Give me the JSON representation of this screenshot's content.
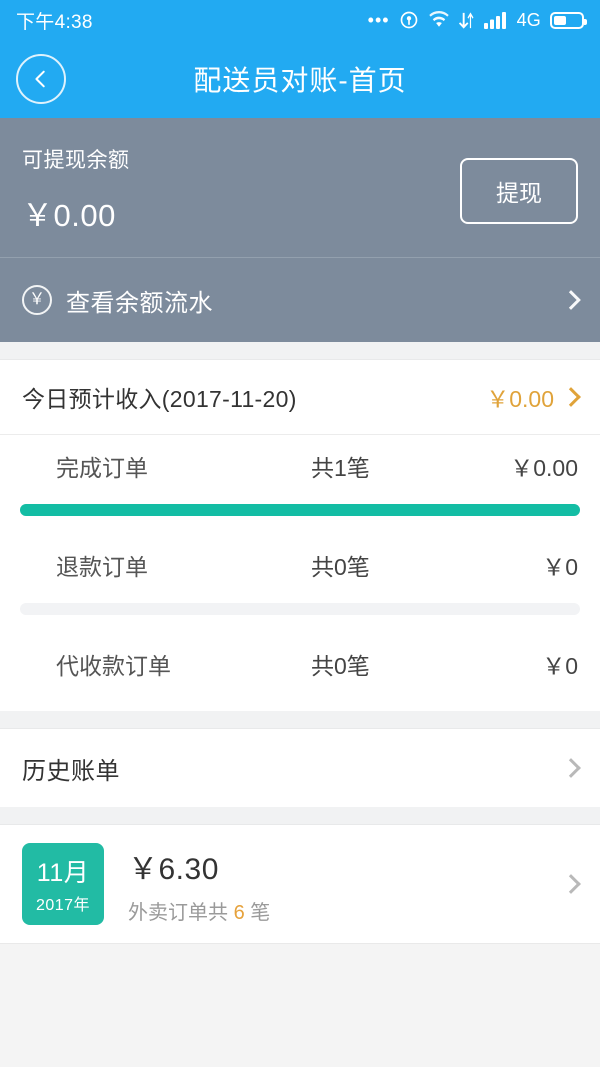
{
  "statusbar": {
    "time": "下午4:38",
    "dots": "•••",
    "network_label": "4G",
    "icons": [
      "more-dots-icon",
      "location-icon",
      "wifi-icon",
      "data-transfer-icon",
      "signal-bars-icon",
      "battery-icon"
    ]
  },
  "navbar": {
    "title": "配送员对账-首页",
    "back_icon": "chevron-left-icon"
  },
  "balance": {
    "label": "可提现余额",
    "amount": "￥0.00",
    "withdraw_label": "提现",
    "bg_color": "#7d8b9c"
  },
  "flow": {
    "icon": "yen-circle-icon",
    "label": "查看余额流水",
    "chevron": "chevron-right-icon"
  },
  "income": {
    "title": "今日预计收入(2017-11-20)",
    "amount": "￥0.00",
    "amount_color": "#e0a33a",
    "chevron": "chevron-right-icon",
    "rows": [
      {
        "name": "完成订单",
        "count": "共1笔",
        "amount": "￥0.00",
        "progress": 100,
        "bar_color": "#13bda4"
      },
      {
        "name": "退款订单",
        "count": "共0笔",
        "amount": "￥0",
        "progress": 0,
        "bar_color": "#13bda4"
      },
      {
        "name": "代收款订单",
        "count": "共0笔",
        "amount": "￥0"
      }
    ]
  },
  "history": {
    "title": "历史账单",
    "chevron": "chevron-right-icon",
    "items": [
      {
        "month": "11月",
        "year": "2017年",
        "amount": "￥6.30",
        "sub_prefix": "外卖订单共",
        "sub_count": "6",
        "sub_suffix": "笔",
        "badge_color": "#22bba4"
      }
    ]
  }
}
